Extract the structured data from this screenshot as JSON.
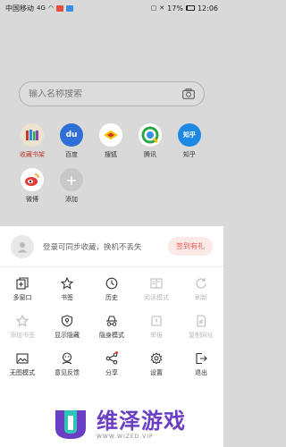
{
  "status_bar": {
    "carrier": "中国移动",
    "signal": "4G",
    "battery": "17%",
    "time": "12:06"
  },
  "search": {
    "placeholder": "输入名称搜索",
    "icon": "camera-icon"
  },
  "shortcuts": [
    {
      "label": "收藏书架",
      "icon": "bookshelf-icon",
      "color": "#c0392b"
    },
    {
      "label": "百度",
      "icon": "baidu-icon",
      "color": "#2f6fd6"
    },
    {
      "label": "搜狐",
      "icon": "sohu-icon",
      "color": "#f3c200"
    },
    {
      "label": "腾讯",
      "icon": "tencent-icon",
      "color": "#2ca84a"
    },
    {
      "label": "知乎",
      "icon": "zhihu-icon",
      "color": "#1e88e5"
    },
    {
      "label": "微博",
      "icon": "weibo-icon",
      "color": "#e53935"
    },
    {
      "label": "添加",
      "icon": "add-icon",
      "color": "#c8c8c8"
    }
  ],
  "account": {
    "tip": "登录可同步收藏，换机不丢失",
    "checkin_label": "签到有礼"
  },
  "menu": [
    {
      "label": "多窗口",
      "icon": "multi-window-icon",
      "enabled": true
    },
    {
      "label": "书签",
      "icon": "star-icon",
      "enabled": true
    },
    {
      "label": "历史",
      "icon": "clock-icon",
      "enabled": true
    },
    {
      "label": "阅读模式",
      "icon": "reading-mode-icon",
      "enabled": false
    },
    {
      "label": "刷新",
      "icon": "refresh-icon",
      "enabled": false
    },
    {
      "label": "添加书签",
      "icon": "add-bookmark-icon",
      "enabled": false
    },
    {
      "label": "显示隐藏",
      "icon": "shield-icon",
      "enabled": true
    },
    {
      "label": "隐身模式",
      "icon": "incognito-icon",
      "enabled": true
    },
    {
      "label": "举报",
      "icon": "report-icon",
      "enabled": false
    },
    {
      "label": "复制网址",
      "icon": "copy-link-icon",
      "enabled": false
    },
    {
      "label": "无图模式",
      "icon": "no-image-icon",
      "enabled": true
    },
    {
      "label": "意见反馈",
      "icon": "feedback-icon",
      "enabled": true
    },
    {
      "label": "分享",
      "icon": "share-icon",
      "enabled": true,
      "badge": true
    },
    {
      "label": "设置",
      "icon": "gear-icon",
      "enabled": true
    },
    {
      "label": "退出",
      "icon": "exit-icon",
      "enabled": true
    }
  ],
  "watermark": {
    "title": "维泽游戏",
    "subtitle": "WWW.WIZED.VIP",
    "color": "#6b3fc4"
  }
}
